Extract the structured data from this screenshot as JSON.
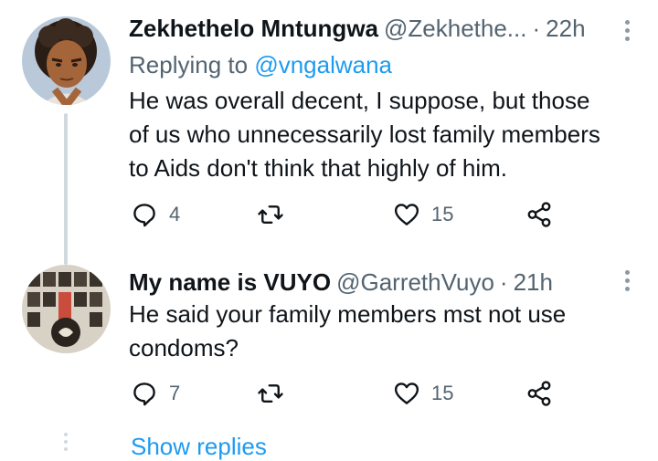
{
  "tweets": [
    {
      "author_name": "Zekhethelo Mntungwa",
      "author_handle": "@Zekhethe...",
      "separator": "·",
      "time": "22h",
      "replying_label": "Replying to",
      "replying_to": "@vngalwana",
      "lines": [
        "He was overall decent, I suppose, but those",
        "of us who unnecessarily lost family members",
        "to Aids don't think that highly of him."
      ],
      "reply_count": "4",
      "retweet_count": "",
      "like_count": "15"
    },
    {
      "author_name": "My name is VUYO",
      "author_handle": "@GarrethVuyo",
      "separator": "·",
      "time": "21h",
      "lines": [
        "He said your family members mst not use",
        "condoms?"
      ],
      "reply_count": "7",
      "retweet_count": "",
      "like_count": "15"
    }
  ],
  "show_replies_label": "Show replies",
  "icons": {
    "reply": "reply-bubble-icon",
    "retweet": "retweet-icon",
    "like": "heart-icon",
    "share": "share-icon",
    "more": "more-vertical-icon"
  },
  "colors": {
    "link": "#1d9bf0",
    "secondary": "#536471",
    "thread_line": "#cfd9de"
  }
}
